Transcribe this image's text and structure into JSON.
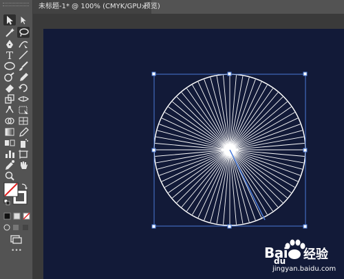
{
  "document_tab": {
    "title": "未标题-1* @ 100% (CMYK/GPU 预览)",
    "close": "×"
  },
  "toolbar": {
    "more_label": "•••"
  },
  "colors": {
    "panel": "#535353",
    "artboard": "#121a38",
    "selection": "#4a7bd9",
    "lines": "#ffffff"
  },
  "artwork": {
    "shape": "circle with radial lines",
    "ray_count": 72
  },
  "watermark": {
    "brand": "Bai",
    "brand2": "du",
    "product": "经验",
    "url": "jingyan.baidu.com"
  }
}
